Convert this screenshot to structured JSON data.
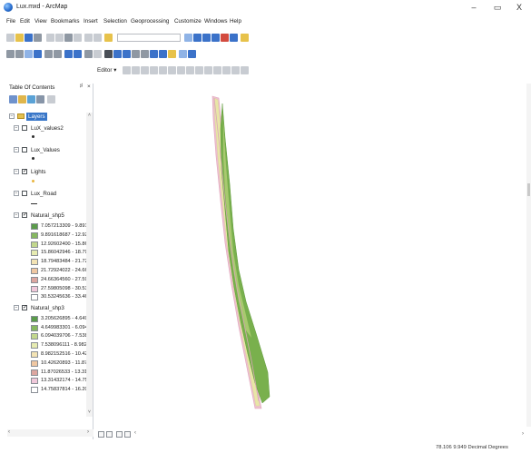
{
  "window": {
    "title": "Lux.mxd - ArcMap",
    "minimize": "–",
    "maximize": "▭",
    "close": "X"
  },
  "menu": [
    "File",
    "Edit",
    "View",
    "Bookmarks",
    "Insert",
    "Selection",
    "Geoprocessing",
    "Customize",
    "Windows",
    "Help"
  ],
  "editor_toolbar": {
    "label": "Editor ▾"
  },
  "toc": {
    "title": "Table Of Contents",
    "pin": "♯",
    "close": "×",
    "root": "Layers",
    "layers": [
      {
        "name": "LuX_values2",
        "checked": false,
        "symbol": "point",
        "symbol_color": "#2e2e2e"
      },
      {
        "name": "Lux_Values",
        "checked": false,
        "symbol": "point",
        "symbol_color": "#2e2e2e"
      },
      {
        "name": "Lights",
        "checked": true,
        "symbol": "point",
        "symbol_color": "#e9b640"
      },
      {
        "name": "Lux_Road",
        "checked": false,
        "symbol": "line",
        "symbol_color": "#2e2e2e"
      },
      {
        "name": "Natural_shp5",
        "checked": true,
        "symbol": "classes",
        "classes": [
          {
            "label": "7.057213309 - 9.891",
            "color": "#5b9c4a"
          },
          {
            "label": "9.891618687 - 12.92",
            "color": "#86b860"
          },
          {
            "label": "12.92602400 - 15.86",
            "color": "#c2d78d"
          },
          {
            "label": "15.86042946 - 18.79",
            "color": "#e6ebb1"
          },
          {
            "label": "18.79483484 - 21.72",
            "color": "#f3e3b4"
          },
          {
            "label": "21.72924022 - 24.66",
            "color": "#efc7a2"
          },
          {
            "label": "24.66364560 - 27.598",
            "color": "#dca6a0"
          },
          {
            "label": "27.59805098 - 30.53",
            "color": "#f0c8da"
          },
          {
            "label": "30.53245636 - 33.46",
            "color": "#ffffff"
          }
        ]
      },
      {
        "name": "Natural_shp3",
        "checked": true,
        "symbol": "classes",
        "classes": [
          {
            "label": "3.205626895 - 4.649",
            "color": "#5b9c4a"
          },
          {
            "label": "4.649983301 - 6.094",
            "color": "#86b860"
          },
          {
            "label": "6.094039706 - 7.538",
            "color": "#c2d78d"
          },
          {
            "label": "7.538096111 - 8.982",
            "color": "#e6ebb1"
          },
          {
            "label": "8.982152516 - 10.42",
            "color": "#f3e3b4"
          },
          {
            "label": "10.42620893 - 11.87",
            "color": "#efc7a2"
          },
          {
            "label": "11.87026533 - 13.31",
            "color": "#dca6a0"
          },
          {
            "label": "13.31432174 - 14.75",
            "color": "#f0c8da"
          },
          {
            "label": "14.75837814 - 16.20",
            "color": "#ffffff"
          }
        ]
      }
    ]
  },
  "status": {
    "coordinates": "78.106  9.949 Decimal Degrees"
  },
  "colors": {
    "selection": "#3876c8",
    "map_green": "#6ea84a",
    "map_yellow": "#e4e39c",
    "map_pink": "#e2a7bd"
  }
}
